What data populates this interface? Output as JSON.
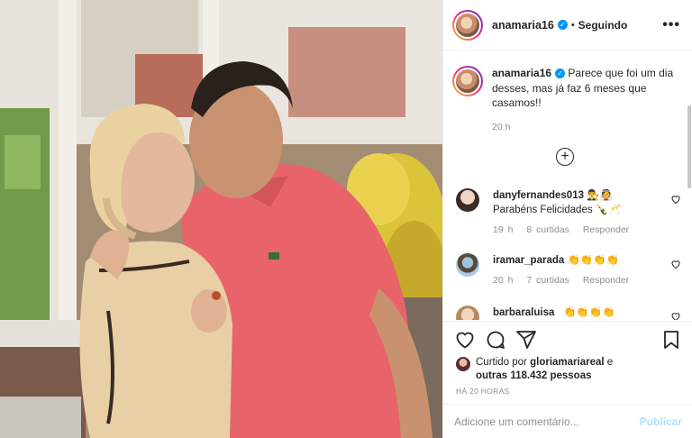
{
  "post": {
    "username": "anamaria16",
    "follow_status": "Seguindo",
    "caption": "Parece que foi um dia desses, mas já faz 6 meses que casamos!!",
    "caption_time": "20 h"
  },
  "comments": [
    {
      "username": "danyfernandes013",
      "text_line1": "👨‍⚖️👰",
      "text_line2": "Parabéns Felicidades 🍾🥂",
      "time": "19 h",
      "likes": "8 curtidas",
      "reply": "Responder"
    },
    {
      "username": "iramar_parada",
      "text_line1": "👏👏👏👏",
      "text_line2": "",
      "time": "20 h",
      "likes": "7 curtidas",
      "reply": "Responder"
    },
    {
      "username": "barbaraluisa",
      "text_line1": "👏👏👏👏",
      "text_line2": "",
      "time": "",
      "likes": "",
      "reply": ""
    }
  ],
  "likes_summary": {
    "prefix": "Curtido por",
    "user": "gloriamariareal",
    "suffix": "e",
    "others": "outras 118.432 pessoas"
  },
  "post_age": "HÁ 20 HORAS",
  "comment_box": {
    "placeholder": "Adicione um comentário...",
    "publish_label": "Publicar"
  },
  "icons": {
    "verified": "verified-badge-icon",
    "more": "more-options-icon",
    "plus": "load-more-comments-icon",
    "heart": "heart-icon",
    "comment": "comment-icon",
    "share": "share-icon",
    "bookmark": "bookmark-icon"
  },
  "colors": {
    "accent": "#0095f6",
    "publish_disabled": "#b2dffc",
    "muted": "#8e8e8e"
  }
}
